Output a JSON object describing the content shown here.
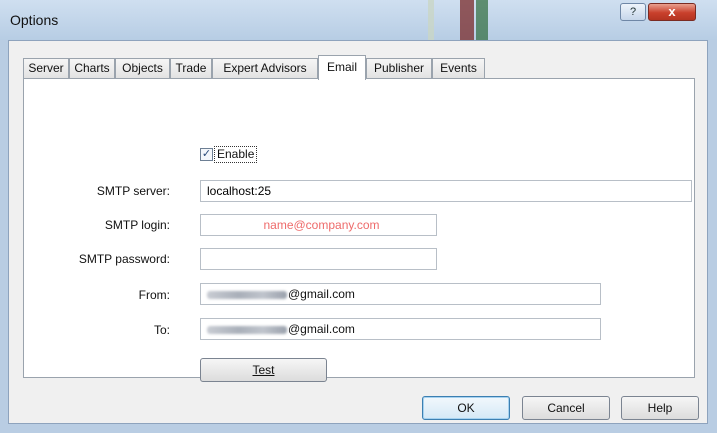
{
  "window": {
    "title": "Options",
    "help_label": "?",
    "close_label": "x"
  },
  "tabs": [
    {
      "label": "Server"
    },
    {
      "label": "Charts"
    },
    {
      "label": "Objects"
    },
    {
      "label": "Trade"
    },
    {
      "label": "Expert Advisors"
    },
    {
      "label": "Email",
      "active": true
    },
    {
      "label": "Publisher"
    },
    {
      "label": "Events"
    }
  ],
  "email": {
    "enable_label": "Enable",
    "enable_checked": true,
    "smtp_server_label": "SMTP server:",
    "smtp_server_value": "localhost:25",
    "smtp_login_label": "SMTP login:",
    "smtp_login_placeholder": "name@company.com",
    "smtp_password_label": "SMTP password:",
    "from_label": "From:",
    "from_value": "@gmail.com",
    "to_label": "To:",
    "to_value": "@gmail.com",
    "test_label": "Test"
  },
  "buttons": {
    "ok": "OK",
    "cancel": "Cancel",
    "help": "Help"
  }
}
